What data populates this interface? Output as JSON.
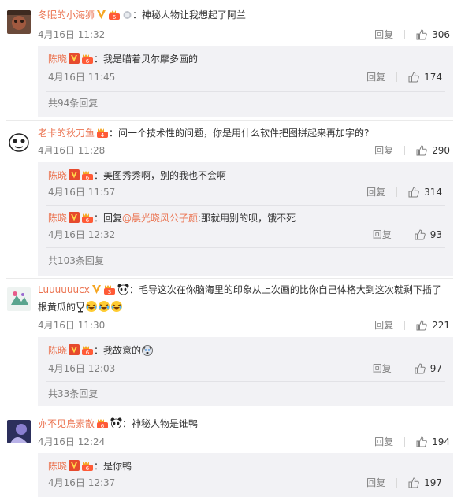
{
  "colors": {
    "username": "#eb7350",
    "meta": "#808080",
    "subbox_bg": "#f2f2f5",
    "v_badge": "#f5a623",
    "vip_badge": "#ff5a36"
  },
  "threads": [
    {
      "user": "冬眠的小海狮",
      "text": "神秘人物让我想起了阿兰",
      "date": "4月16日 11:32",
      "reply_label": "回复",
      "likes": "306",
      "replies": [
        {
          "user": "陈晓",
          "text": "我是瞄着贝尔摩多画的",
          "date": "4月16日 11:45",
          "reply_label": "回复",
          "likes": "174"
        }
      ],
      "more": "共94条回复"
    },
    {
      "user": "老卡的秋刀鱼",
      "text": "问一个技术性的问题，你是用什么软件把图拼起来再加字的?",
      "date": "4月16日 11:28",
      "reply_label": "回复",
      "likes": "290",
      "replies": [
        {
          "user": "陈晓",
          "text": "美图秀秀啊，别的我也不会啊",
          "date": "4月16日 11:57",
          "reply_label": "回复",
          "likes": "314"
        },
        {
          "user": "陈晓",
          "text_prefix": "回复",
          "mention": "@晨光晓风公子颜",
          "text": ":那就用别的呗，饿不死",
          "date": "4月16日 12:32",
          "reply_label": "回复",
          "likes": "93"
        }
      ],
      "more": "共103条回复"
    },
    {
      "user": "Luuuuuucx",
      "text": "毛导这次在你脑海里的印象从上次画的比你自己体格大到这次就剩下插了根黄瓜的",
      "date": "4月16日 11:30",
      "reply_label": "回复",
      "likes": "221",
      "replies": [
        {
          "user": "陈晓",
          "text": "我故意的",
          "date": "4月16日 12:03",
          "reply_label": "回复",
          "likes": "97"
        }
      ],
      "more": "共33条回复"
    },
    {
      "user": "亦不见烏素散",
      "text": "神秘人物是谁鸭",
      "date": "4月16日 12:24",
      "reply_label": "回复",
      "likes": "194",
      "replies": [
        {
          "user": "陈晓",
          "text": "是你鸭",
          "date": "4月16日 12:37",
          "reply_label": "回复",
          "likes": "197"
        }
      ]
    }
  ]
}
